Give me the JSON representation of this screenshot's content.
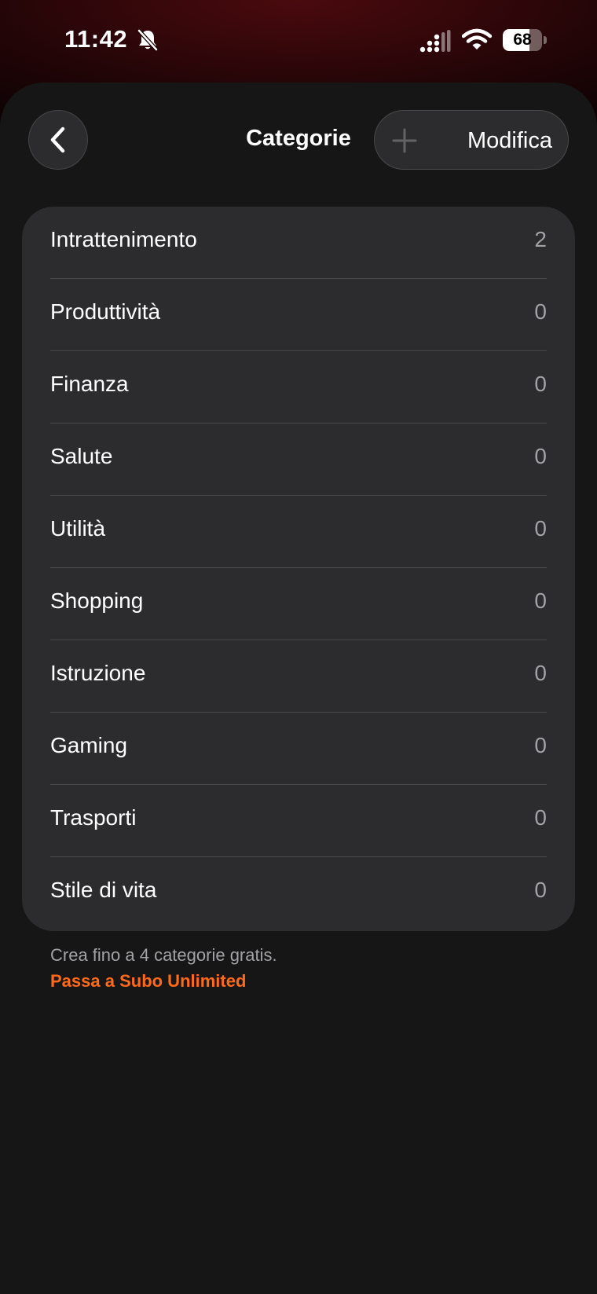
{
  "status_bar": {
    "time": "11:42",
    "battery": "68",
    "battery_fraction": 0.68
  },
  "icons": {
    "bell": "bell-slash-icon",
    "signal": "cellular-signal-icon",
    "wifi": "wifi-icon",
    "back": "chevron-left-icon",
    "add": "plus-icon"
  },
  "header": {
    "title": "Categorie",
    "edit_label": "Modifica"
  },
  "categories": [
    {
      "label": "Intrattenimento",
      "count": "2"
    },
    {
      "label": "Produttività",
      "count": "0"
    },
    {
      "label": "Finanza",
      "count": "0"
    },
    {
      "label": "Salute",
      "count": "0"
    },
    {
      "label": "Utilità",
      "count": "0"
    },
    {
      "label": "Shopping",
      "count": "0"
    },
    {
      "label": "Istruzione",
      "count": "0"
    },
    {
      "label": "Gaming",
      "count": "0"
    },
    {
      "label": "Trasporti",
      "count": "0"
    },
    {
      "label": "Stile di vita",
      "count": "0"
    }
  ],
  "footer": {
    "note": "Crea fino a 4 categorie gratis.",
    "upgrade_label": "Passa a Subo Unlimited"
  },
  "colors": {
    "accent": "#ff6a1a",
    "sheet_background": "#161616",
    "card_background": "#2c2c2e",
    "secondary_text": "#a1a1a6"
  }
}
